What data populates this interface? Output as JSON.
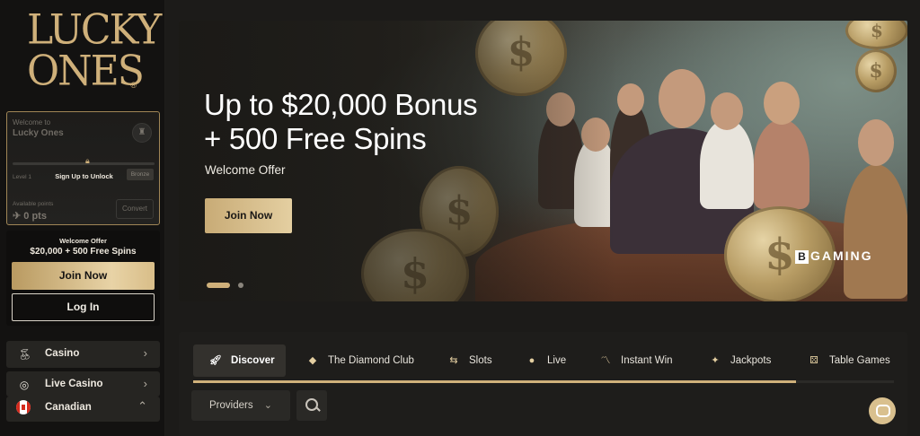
{
  "brand": {
    "line1": "LUCKY",
    "line2": "ONES",
    "reg": "®"
  },
  "loyalty": {
    "welcome": "Welcome to",
    "name": "Lucky Ones",
    "unlock": "Sign Up to Unlock",
    "level": "Level 1",
    "tier": "Bronze",
    "available_label": "Available points",
    "points": "0 pts",
    "convert": "Convert"
  },
  "offer": {
    "label": "Welcome Offer",
    "text": "$20,000 + 500 Free Spins",
    "join": "Join Now",
    "login": "Log In"
  },
  "sidebar": {
    "items": [
      {
        "label": "Casino",
        "icon": "cherries-icon"
      },
      {
        "label": "Live Casino",
        "icon": "chip-icon"
      }
    ],
    "region": {
      "label": "Canadian",
      "icon": "canada-flag-icon"
    }
  },
  "hero": {
    "title_line1": "Up to $20,000 Bonus",
    "title_line2": "+ 500 Free Spins",
    "subtitle": "Welcome Offer",
    "cta": "Join Now",
    "provider": "BGAMING",
    "provider_letter": "B",
    "provider_rest": "GAMING",
    "slides": 2,
    "active_slide": 1
  },
  "categories": {
    "tabs": [
      {
        "label": "Discover",
        "icon": "rocket-icon",
        "active": true
      },
      {
        "label": "The Diamond Club",
        "icon": "diamond-icon"
      },
      {
        "label": "Slots",
        "icon": "slots-icon"
      },
      {
        "label": "Live",
        "icon": "live-icon"
      },
      {
        "label": "Instant Win",
        "icon": "trend-icon"
      },
      {
        "label": "Jackpots",
        "icon": "sparkle-icon"
      },
      {
        "label": "Table Games",
        "icon": "dice-icon"
      }
    ],
    "scroll_progress": 0.86,
    "providers_label": "Providers"
  },
  "colors": {
    "gold": "#cfb07a",
    "bg": "#1c1b19",
    "sidebar": "#131211"
  }
}
